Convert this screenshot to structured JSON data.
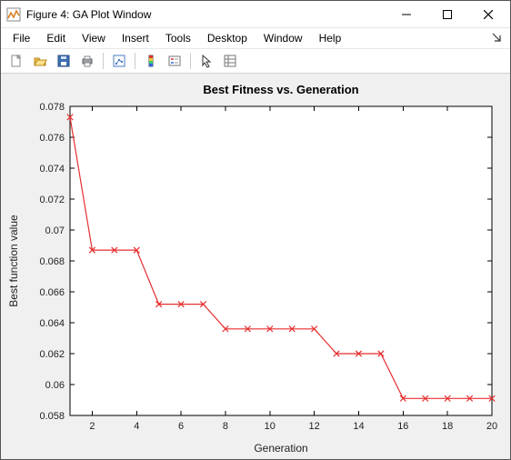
{
  "window": {
    "title": "Figure 4: GA Plot Window"
  },
  "menu": {
    "items": [
      "File",
      "Edit",
      "View",
      "Insert",
      "Tools",
      "Desktop",
      "Window",
      "Help"
    ]
  },
  "toolbar": {
    "icons": [
      "new-figure-icon",
      "open-icon",
      "save-icon",
      "print-icon",
      "sep",
      "link-plot-icon",
      "sep",
      "insert-colorbar-icon",
      "insert-legend-icon",
      "sep",
      "edit-plot-icon",
      "property-inspector-icon"
    ]
  },
  "chart_data": {
    "type": "line",
    "title": "Best Fitness vs. Generation",
    "xlabel": "Generation",
    "ylabel": "Best function value",
    "xlim": [
      1,
      20
    ],
    "ylim": [
      0.058,
      0.078
    ],
    "xticks": [
      2,
      4,
      6,
      8,
      10,
      12,
      14,
      16,
      18,
      20
    ],
    "yticks": [
      0.058,
      0.06,
      0.062,
      0.064,
      0.066,
      0.068,
      0.07,
      0.072,
      0.074,
      0.076,
      0.078
    ],
    "x": [
      1,
      2,
      3,
      4,
      5,
      6,
      7,
      8,
      9,
      10,
      11,
      12,
      13,
      14,
      15,
      16,
      17,
      18,
      19,
      20
    ],
    "values": [
      0.0773,
      0.0687,
      0.0687,
      0.0687,
      0.0652,
      0.0652,
      0.0652,
      0.0636,
      0.0636,
      0.0636,
      0.0636,
      0.0636,
      0.062,
      0.062,
      0.062,
      0.0591,
      0.0591,
      0.0591,
      0.0591,
      0.0591
    ],
    "marker": "x",
    "color": "#e72f2f"
  }
}
